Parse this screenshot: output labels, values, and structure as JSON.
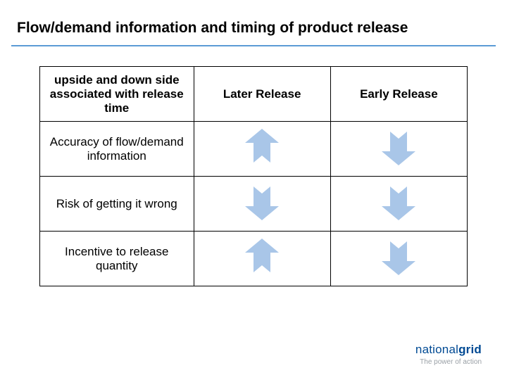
{
  "title": "Flow/demand information and timing of product release",
  "table": {
    "headers": {
      "row_header": "upside and down side associated with release time",
      "col2": "Later Release",
      "col3": "Early Release"
    },
    "rows": [
      {
        "label": "Accuracy of flow/demand information",
        "later": "up",
        "early": "down"
      },
      {
        "label": "Risk of getting it wrong",
        "later": "down",
        "early": "down"
      },
      {
        "label": "Incentive to release quantity",
        "later": "up",
        "early": "down"
      }
    ]
  },
  "brand": {
    "part1": "national",
    "part2": "grid",
    "tagline": "The power of action"
  },
  "arrow_color": "#a9c6e8"
}
